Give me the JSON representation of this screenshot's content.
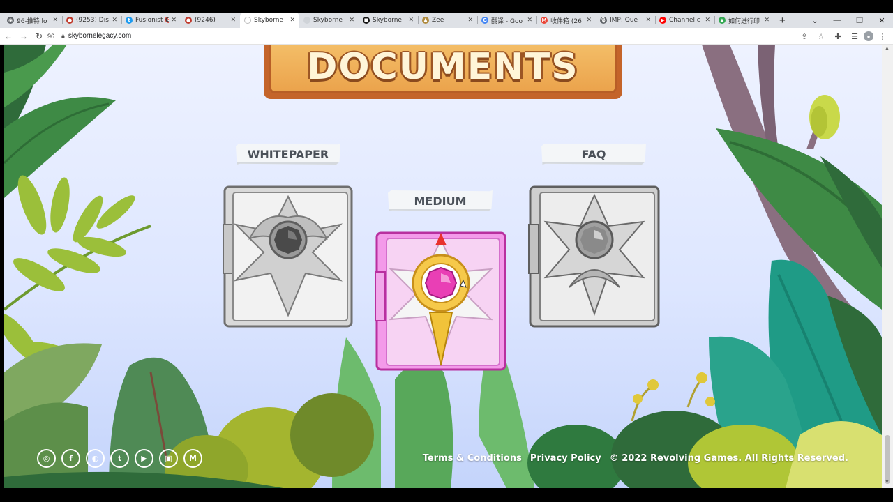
{
  "browser": {
    "tabs": [
      {
        "label": "96-推特 lo",
        "fav_color": "#5f6368",
        "fav_glyph": "◉"
      },
      {
        "label": "(9253) Dis",
        "fav_color": "#c0392b",
        "fav_glyph": "●"
      },
      {
        "label": "Fusionist 🔇",
        "fav_color": "#1d9bf0",
        "fav_glyph": "t"
      },
      {
        "label": "(9246)",
        "fav_color": "#c0392b",
        "fav_glyph": "●"
      },
      {
        "label": "Skyborne",
        "fav_color": "#ffffff",
        "fav_glyph": ""
      },
      {
        "label": "Skyborne",
        "fav_color": "#cfd3d8",
        "fav_glyph": ""
      },
      {
        "label": "Skyborne",
        "fav_color": "#111111",
        "fav_glyph": "■"
      },
      {
        "label": "Zee",
        "fav_color": "#b08b3e",
        "fav_glyph": "♟"
      },
      {
        "label": "翻译 - Goo",
        "fav_color": "#4285f4",
        "fav_glyph": "G"
      },
      {
        "label": "收件箱 (26",
        "fav_color": "#ea4335",
        "fav_glyph": "M"
      },
      {
        "label": "IMP: Que",
        "fav_color": "#5f6368",
        "fav_glyph": "🎙"
      },
      {
        "label": "Channel c",
        "fav_color": "#ff0000",
        "fav_glyph": "▶"
      },
      {
        "label": "如何进行印",
        "fav_color": "#34a853",
        "fav_glyph": "▲"
      }
    ],
    "active_tab_index": 4,
    "new_tab_label": "+",
    "zoom_label": "96",
    "url": "skybornelegacy.com"
  },
  "page": {
    "banner_title": "DOCUMENTS",
    "documents": [
      {
        "key": "whitepaper",
        "label": "WHITEPAPER"
      },
      {
        "key": "medium",
        "label": "MEDIUM"
      },
      {
        "key": "faq",
        "label": "FAQ"
      }
    ],
    "socials": [
      {
        "name": "instagram",
        "glyph": "◎"
      },
      {
        "name": "facebook",
        "glyph": "f"
      },
      {
        "name": "discord",
        "glyph": "◐"
      },
      {
        "name": "twitter",
        "glyph": "t"
      },
      {
        "name": "youtube",
        "glyph": "▶"
      },
      {
        "name": "twitch",
        "glyph": "▣"
      },
      {
        "name": "medium",
        "glyph": "M"
      }
    ],
    "footer": {
      "terms": "Terms & Conditions",
      "privacy": "Privacy Policy",
      "copyright": "© 2022 Revolving Games. All Rights Reserved."
    }
  },
  "colors": {
    "banner_orange": "#eba34c",
    "medium_pink": "#e56ad9",
    "gem_gold": "#f3c330",
    "foliage_dark": "#2f6b3a"
  }
}
